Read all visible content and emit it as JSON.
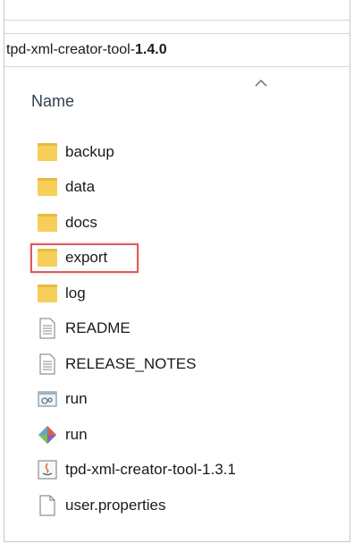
{
  "address": {
    "prefix": "tpd-xml-creator-tool-",
    "version": "1.4.0"
  },
  "column_header": {
    "name_label": "Name",
    "sort_icon": "chevron-up-icon"
  },
  "items": [
    {
      "label": "backup",
      "icon": "folder-icon"
    },
    {
      "label": "data",
      "icon": "folder-icon"
    },
    {
      "label": "docs",
      "icon": "folder-icon"
    },
    {
      "label": "export",
      "icon": "folder-icon",
      "highlighted": true
    },
    {
      "label": "log",
      "icon": "folder-icon"
    },
    {
      "label": "README",
      "icon": "text-file-icon"
    },
    {
      "label": "RELEASE_NOTES",
      "icon": "text-file-icon"
    },
    {
      "label": "run",
      "icon": "batch-file-icon"
    },
    {
      "label": "run",
      "icon": "shell-script-icon"
    },
    {
      "label": "tpd-xml-creator-tool-1.3.1",
      "icon": "java-jar-icon"
    },
    {
      "label": "user.properties",
      "icon": "blank-file-icon"
    }
  ],
  "colors": {
    "folder": "#f5cf5a",
    "highlight_border": "#e05a5a"
  }
}
